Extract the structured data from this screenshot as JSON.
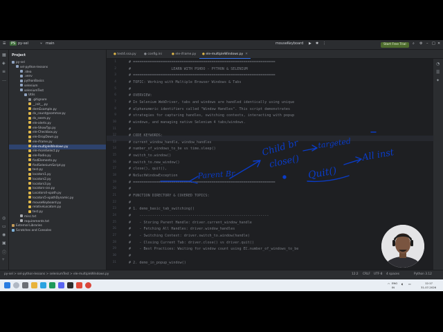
{
  "titlebar": {
    "project": "py-sel",
    "branch": "main",
    "run_config": "mouseKeyboard",
    "trial_button": "Start Free Trial"
  },
  "project_panel": {
    "title": "Project",
    "items": [
      {
        "label": "py-sel",
        "icon": "folder-icon"
      },
      {
        "label": "sel-python-lessons",
        "icon": "folder-icon"
      },
      {
        "label": ".idea",
        "icon": "folder-icon"
      },
      {
        "label": ".venv",
        "icon": "folder-icon"
      },
      {
        "label": "pythonBasics",
        "icon": "folder-icon"
      },
      {
        "label": "selenium",
        "icon": "folder-icon"
      },
      {
        "label": "seleniumTest",
        "icon": "folder-icon"
      },
      {
        "label": "Utils",
        "icon": "folder-icon"
      },
      {
        "label": ".gitignore",
        "icon": "file-icon"
      },
      {
        "label": "__init__.py",
        "icon": "python-file-icon"
      },
      {
        "label": "demExample.py",
        "icon": "python-file-icon"
      },
      {
        "label": "dx_count@sommar.py",
        "icon": "python-file-icon"
      },
      {
        "label": "dx_seem.py",
        "icon": "python-file-icon"
      },
      {
        "label": "ele-alerts.py",
        "icon": "python-file-icon"
      },
      {
        "label": "ele-ShowTyp.py",
        "icon": "python-file-icon"
      },
      {
        "label": "ele-Checkbox.py",
        "icon": "python-file-icon"
      },
      {
        "label": "ele-DropDown.py",
        "icon": "python-file-icon"
      },
      {
        "label": "ele-iframe.py",
        "icon": "python-file-icon"
      },
      {
        "label": "ele-multipleWindows.py",
        "icon": "python-file-icon"
      },
      {
        "label": "ele-moreSelect.py",
        "icon": "python-file-icon"
      },
      {
        "label": "ele-Radio.py",
        "icon": "python-file-icon"
      },
      {
        "label": "findElements.py",
        "icon": "python-file-icon"
      },
      {
        "label": "findSeleniumScript.py",
        "icon": "python-file-icon"
      },
      {
        "label": "test.py",
        "icon": "python-file-icon"
      },
      {
        "label": "locators1.py",
        "icon": "python-file-icon"
      },
      {
        "label": "locators2.py",
        "icon": "python-file-icon"
      },
      {
        "label": "locators3.py",
        "icon": "python-file-icon"
      },
      {
        "label": "locators-css.py",
        "icon": "python-file-icon"
      },
      {
        "label": "Locators4-xpath.py",
        "icon": "python-file-icon"
      },
      {
        "label": "locators5-xpathDynamic.py",
        "icon": "python-file-icon"
      },
      {
        "label": "mouseKeyboard.py",
        "icon": "python-file-icon"
      },
      {
        "label": "relativeLocators.py",
        "icon": "python-file-icon"
      },
      {
        "label": "test.py",
        "icon": "python-file-icon"
      },
      {
        "label": "misc.txt",
        "icon": "text-file-icon"
      },
      {
        "label": "requirements.txt",
        "icon": "text-file-icon"
      },
      {
        "label": "External Libraries",
        "icon": "library-icon"
      },
      {
        "label": "Scratches and Consoles",
        "icon": "scratch-icon"
      }
    ]
  },
  "tabs": [
    {
      "label": "test4.ssa.py"
    },
    {
      "label": "config.ini"
    },
    {
      "label": "ele-iframe.py"
    },
    {
      "label": "ele-multipleWindows.py"
    }
  ],
  "editor": {
    "lines": [
      {
        "n": "1",
        "text": "# ==================================================================="
      },
      {
        "n": "2",
        "text": "#                   LEARN WITH PSHDO - PYTHON & SELENIUM"
      },
      {
        "n": "3",
        "text": "# ==================================================================="
      },
      {
        "n": "4",
        "text": "# TOPIC: Working with Multiple Browser Windows & Tabs"
      },
      {
        "n": "5",
        "text": "#"
      },
      {
        "n": "6",
        "text": "# OVERVIEW:"
      },
      {
        "n": "7",
        "text": "# In Selenium WebDriver, tabs and windows are handled identically using unique"
      },
      {
        "n": "8",
        "text": "# alphanumeric identifiers called \"Window Handles\". This script demonstrates"
      },
      {
        "n": "9",
        "text": "# strategies for capturing handles, switching contexts, interacting with popup"
      },
      {
        "n": "10",
        "text": "# windows, and managing native Selenium 4 tabs/windows."
      },
      {
        "n": "11",
        "text": "#"
      },
      {
        "n": "12",
        "text": "# CODE KEYWORDS:"
      },
      {
        "n": "13",
        "text": "# current_window_handle, window_handles"
      },
      {
        "n": "14",
        "text": "# number_of_windows_to_be vs time.sleep()"
      },
      {
        "n": "15",
        "text": "# switch_to.window()"
      },
      {
        "n": "16",
        "text": "# switch_to.new_window()"
      },
      {
        "n": "17",
        "text": "# close(), quit(),"
      },
      {
        "n": "18",
        "text": "# NoSuchWindowException"
      },
      {
        "n": "19",
        "text": "# ==================================================================="
      },
      {
        "n": "20",
        "text": "#"
      },
      {
        "n": "21",
        "text": "# FUNCTION DIRECTORY & COVERED TOPICS:"
      },
      {
        "n": "22",
        "text": "#"
      },
      {
        "n": "23",
        "text": "# 1. demo_basic_tab_switching()"
      },
      {
        "n": "24",
        "text": "#    -------------------------------------------------------------"
      },
      {
        "n": "25",
        "text": "#    - Storing Parent Handle: driver.current_window_handle"
      },
      {
        "n": "26",
        "text": "#    - Fetching All Handles: driver.window_handles"
      },
      {
        "n": "27",
        "text": "#    - Switching Context: driver.switch_to.window(handle)"
      },
      {
        "n": "28",
        "text": "#    - Closing Current Tab: driver.close() vs driver.quit()"
      },
      {
        "n": "29",
        "text": "#    - Best Practices: Waiting for window count using EC.number_of_windows_to_be"
      },
      {
        "n": "30",
        "text": "#"
      },
      {
        "n": "31",
        "text": "# 2. demo_in_popup_window()"
      }
    ]
  },
  "annotations": {
    "parent": "Parent Br",
    "child": "Child br",
    "close": "close()",
    "targeted": "targeted",
    "quit": "Quit()",
    "all_inst": "All inst"
  },
  "status": {
    "breadcrumb": "py-sel > sel-python-lessons > seleniumTest > ele-multipleWindows.py",
    "position": "12:2",
    "line_sep": "CRLF",
    "encoding": "UTF-8",
    "indent": "4 spaces",
    "interpreter": "Python 3.12"
  },
  "taskbar": {
    "lang1": "ENG",
    "lang2": "IN",
    "time": "12:17",
    "date": "31-07-2026"
  },
  "colors": {
    "ink": "#0a3cc8",
    "accent": "#3574f0",
    "trial": "#4d6b2d"
  }
}
